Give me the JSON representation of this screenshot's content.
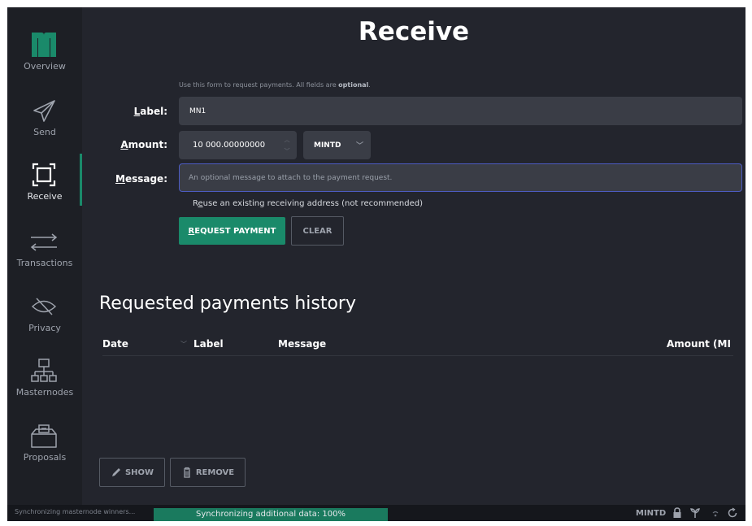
{
  "sidebar": {
    "items": [
      {
        "label": "Overview",
        "icon": "logo-icon"
      },
      {
        "label": "Send",
        "icon": "paper-plane-icon"
      },
      {
        "label": "Receive",
        "icon": "receive-frame-icon",
        "active": true
      },
      {
        "label": "Transactions",
        "icon": "transfer-arrows-icon"
      },
      {
        "label": "Privacy",
        "icon": "eye-slash-icon"
      },
      {
        "label": "Masternodes",
        "icon": "network-icon"
      },
      {
        "label": "Proposals",
        "icon": "ballot-box-icon"
      }
    ]
  },
  "main": {
    "title": "Receive",
    "hint_prefix": "Use this form to request payments. All fields are ",
    "hint_bold": "optional",
    "hint_suffix": ".",
    "form": {
      "label_caption": "abel:",
      "label_caption_underlined": "L",
      "label_value": "MN1",
      "amount_caption_underlined": "A",
      "amount_caption": "mount:",
      "amount_value": "10 000.00000000",
      "unit_selected": "MINTD",
      "message_caption_underlined": "M",
      "message_caption": "essage:",
      "message_placeholder": "An optional message to attach to the payment request.",
      "reuse_prefix": "R",
      "reuse_underlined": "e",
      "reuse_suffix": "use an existing receiving address (not recommended)"
    },
    "buttons": {
      "request_underlined": "R",
      "request_label": "EQUEST PAYMENT",
      "clear_label": "CLEAR",
      "show_label": "SHOW",
      "remove_label": "REMOVE"
    },
    "history": {
      "title": "Requested payments history",
      "columns": [
        "Date",
        "Label",
        "Message",
        "Amount (MI"
      ]
    }
  },
  "status": {
    "left_text": "Synchronizing masternode winners...",
    "progress_text": "Synchronizing additional data: 100%",
    "progress": 1.0,
    "unit": "MINTD"
  },
  "colors": {
    "accent": "#1a8a6a",
    "background": "#23252d",
    "sidebar": "#1d1f25",
    "focus": "#4d5cc2"
  }
}
